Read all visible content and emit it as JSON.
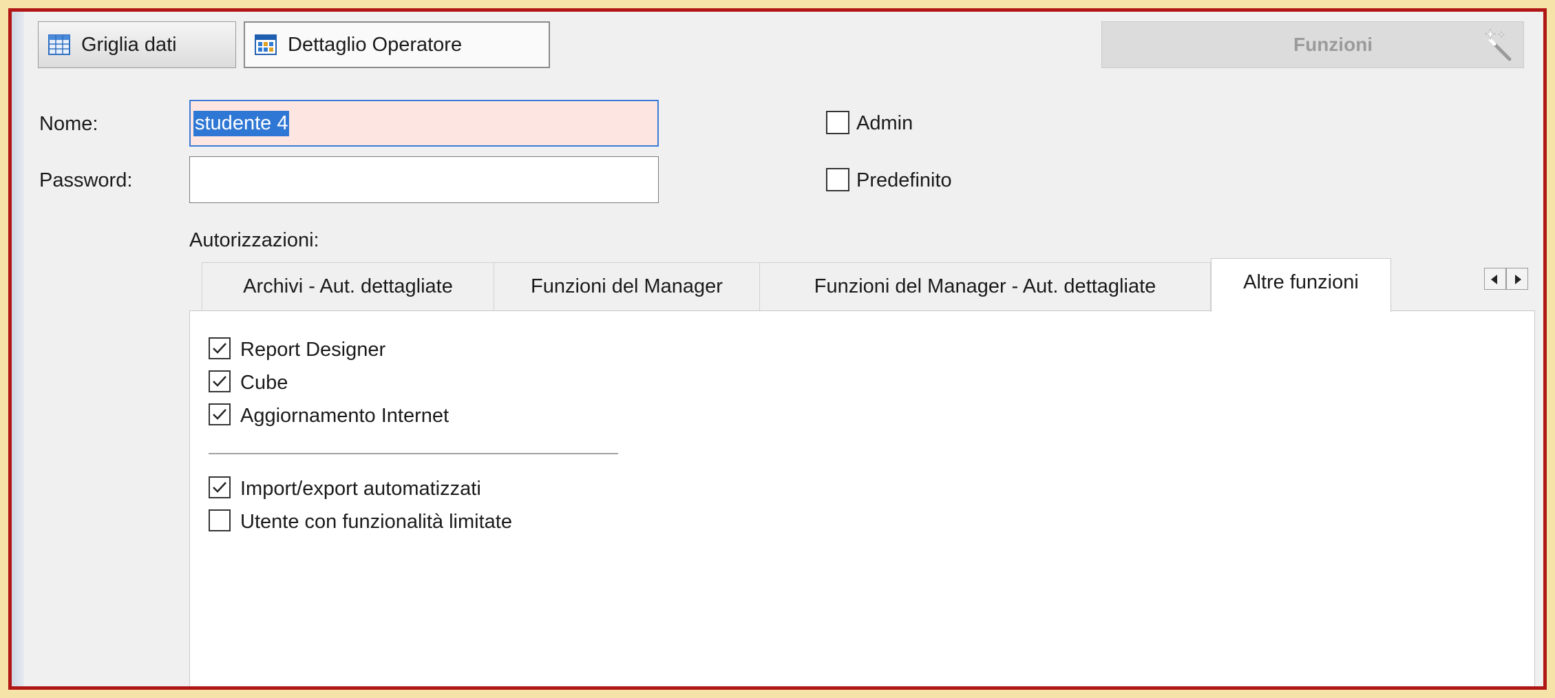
{
  "toolbar": {
    "griglia_label": "Griglia dati",
    "dettaglio_label": "Dettaglio Operatore",
    "funzioni_label": "Funzioni"
  },
  "form": {
    "nome_label": "Nome:",
    "nome_value": "studente 4",
    "password_label": "Password:",
    "password_value": "",
    "admin_label": "Admin",
    "admin_checked": false,
    "predefinito_label": "Predefinito",
    "predefinito_checked": false,
    "autorizzazioni_label": "Autorizzazioni:"
  },
  "tabs": [
    {
      "label": "Archivi - Aut. dettagliate",
      "active": false
    },
    {
      "label": "Funzioni del Manager",
      "active": false
    },
    {
      "label": "Funzioni del Manager - Aut. dettagliate",
      "active": false
    },
    {
      "label": "Altre funzioni",
      "active": true
    }
  ],
  "panel": {
    "group1": [
      {
        "label": "Report Designer",
        "checked": true
      },
      {
        "label": "Cube",
        "checked": true
      },
      {
        "label": "Aggiornamento Internet",
        "checked": true
      }
    ],
    "group2": [
      {
        "label": "Import/export automatizzati",
        "checked": true
      },
      {
        "label": "Utente con funzionalità limitate",
        "checked": false
      }
    ]
  },
  "icons": {
    "griglia": "table-grid-icon",
    "dettaglio": "detail-grid-icon",
    "funzioni": "magic-wand-icon",
    "scroll_left": "arrow-left-icon",
    "scroll_right": "arrow-right-icon"
  }
}
